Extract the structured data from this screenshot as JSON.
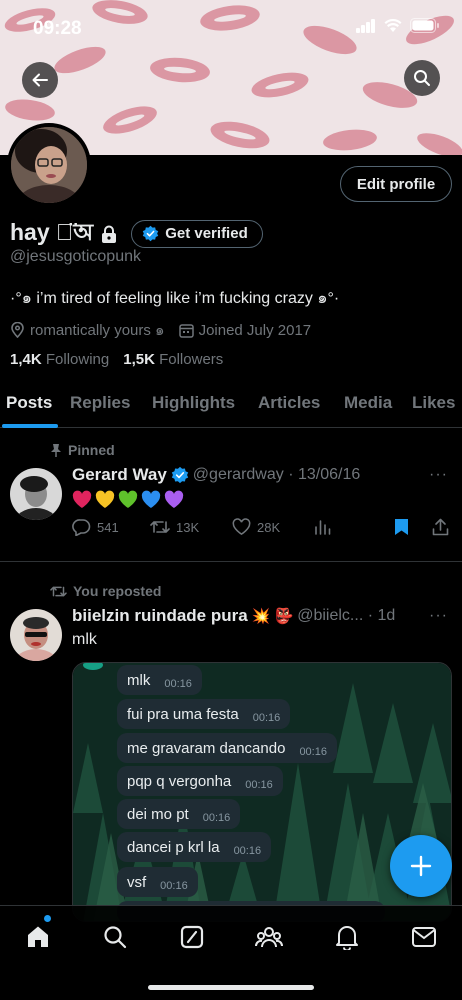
{
  "status_bar": {
    "time": "09:28"
  },
  "profile": {
    "name": "hay ঐ̈অ",
    "verify_label": "Get verified",
    "edit_label": "Edit profile",
    "handle": "@jesusgoticopunk",
    "bio": "·°๑ i’m tired of feeling like i’m fucking crazy ๑°·",
    "location": "romantically yours ๑",
    "joined": "Joined July 2017",
    "following_count": "1,4K",
    "following_label": "Following",
    "followers_count": "1,5K",
    "followers_label": "Followers"
  },
  "tabs": [
    "Posts",
    "Replies",
    "Highlights",
    "Articles",
    "Media",
    "Likes"
  ],
  "pinned_post": {
    "label": "Pinned",
    "author": "Gerard Way",
    "handle_date": "@gerardway · 13/06/16",
    "more": "···",
    "emojis": [
      "❤️",
      "💛",
      "💚",
      "💙",
      "💜"
    ],
    "replies": "541",
    "reposts": "13K",
    "likes": "28K"
  },
  "repost": {
    "label": "You reposted",
    "author": "biielzin ruindade pura",
    "author_emojis": "💥 👺",
    "handle_date": "@biielc... · 1d",
    "more": "···",
    "text": "mlk",
    "messages": [
      {
        "text": "mlk",
        "time": "00:16"
      },
      {
        "text": "fui pra uma festa",
        "time": "00:16"
      },
      {
        "text": "me gravaram dancando",
        "time": "00:16"
      },
      {
        "text": "pqp q vergonha",
        "time": "00:16"
      },
      {
        "text": "dei mo pt",
        "time": "00:16"
      },
      {
        "text": "dancei p krl la",
        "time": "00:16"
      },
      {
        "text": "vsf",
        "time": "00:16"
      }
    ]
  },
  "bottom_nav": [
    "home-icon",
    "search-icon",
    "grok-icon",
    "communities-icon",
    "notifications-icon",
    "messages-icon"
  ],
  "colors": {
    "accent": "#1d9bf0",
    "background": "#000000",
    "muted": "#71767b"
  }
}
